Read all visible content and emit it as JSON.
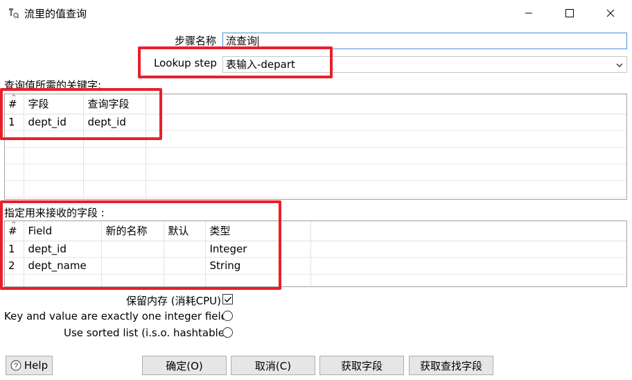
{
  "window": {
    "title": "流里的值查询",
    "controls": {
      "minimize": "—",
      "maximize": "☐",
      "close": "✕"
    }
  },
  "form": {
    "step_name_label": "步骤名称",
    "step_name_value": "流查询",
    "lookup_step_label": "Lookup step",
    "lookup_step_value": "表输入-depart"
  },
  "keys_section": {
    "label": "查询值所需的关键字:",
    "columns": [
      "#",
      "字段",
      "查询字段"
    ],
    "rows": [
      [
        "1",
        "dept_id",
        "dept_id"
      ]
    ]
  },
  "fields_section": {
    "label": "指定用来接收的字段 :",
    "columns": [
      "#",
      "Field",
      "新的名称",
      "默认",
      "类型"
    ],
    "rows": [
      [
        "1",
        "dept_id",
        "",
        "",
        "Integer"
      ],
      [
        "2",
        "dept_name",
        "",
        "",
        "String"
      ]
    ]
  },
  "options": {
    "preserve_memory_label": "保留内存 (消耗CPU)",
    "preserve_memory_checked": true,
    "integer_pair_label": "Key and value are exactly one integer field",
    "sorted_list_label": "Use sorted list (i.s.o. hashtable)"
  },
  "buttons": {
    "help": "Help",
    "ok": "确定(O)",
    "cancel": "取消(C)",
    "get_fields": "获取字段",
    "get_lookup_fields": "获取查找字段"
  },
  "colors": {
    "highlight": "#e8202a",
    "input_focus_border": "#4a8fd6",
    "button_bg": "#e6e6e6"
  }
}
